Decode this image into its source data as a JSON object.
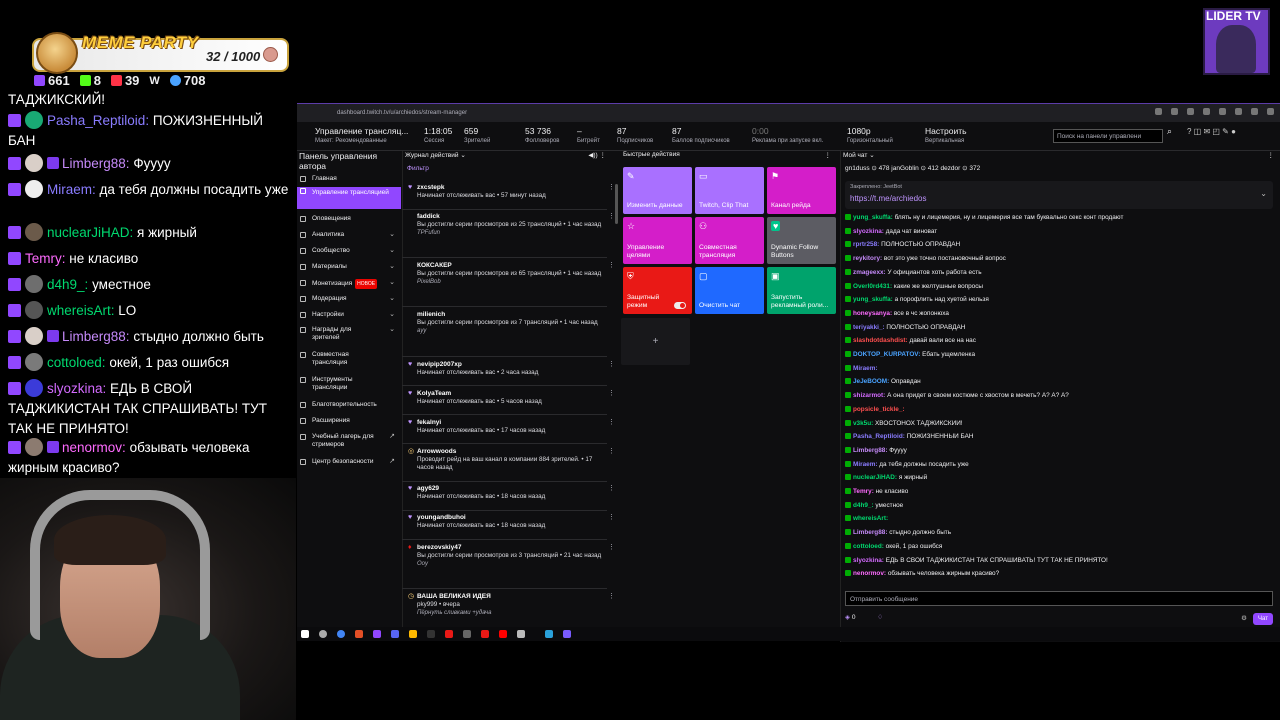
{
  "overlay": {
    "meme_title": "MEME PARTY",
    "meme_count": "32 / 1000",
    "stats": [
      {
        "icon": "twitch-icon",
        "value": "661",
        "color": "#9147ff"
      },
      {
        "icon": "kick-icon",
        "value": "8",
        "color": "#53fc18"
      },
      {
        "icon": "vk-live-icon",
        "value": "39",
        "color": "#ff3347"
      },
      {
        "icon": "w-icon",
        "value": "",
        "color": "#ffffff"
      },
      {
        "icon": "person-icon",
        "value": "708",
        "color": "#4aa3ff"
      }
    ],
    "messages": [
      {
        "user": "",
        "text": "ТАДЖИКСКИЙ!",
        "color": "#ffffff"
      },
      {
        "user": "Pasha_Reptiloid:",
        "text": "ПОЖИЗНЕННЫЙ БАН",
        "color": "#8a7cff"
      },
      {
        "user": "Limberg88:",
        "text": "Фуууу",
        "color": "#c58af9"
      },
      {
        "user": "Miraem:",
        "text": "да тебя должны посадить уже",
        "color": "#8a7cff"
      },
      {
        "user": "nuclearJiHAD:",
        "text": "я жирный",
        "color": "#00d96f"
      },
      {
        "user": "Temry:",
        "text": "не класиво",
        "color": "#ff6bff"
      },
      {
        "user": "d4h9_:",
        "text": "уместное",
        "color": "#00d96f"
      },
      {
        "user": "whereisArt:",
        "text": "LO",
        "color": "#00d96f"
      },
      {
        "user": "Limberg88:",
        "text": "стыдно должно быть",
        "color": "#c58af9"
      },
      {
        "user": "cottoloed:",
        "text": "окей, 1 раз ошибся",
        "color": "#00d96f"
      },
      {
        "user": "slyozkina:",
        "text": "ЕДЬ В СВОЙ ТАДЖИКИСТАН ТАК СПРАШИВАТЬ! ТУТ ТАК НЕ ПРИНЯТО!",
        "color": "#d46bff"
      },
      {
        "user": "nenormov:",
        "text": "обзывать человека жирным красиво?",
        "color": "#ff6bff"
      }
    ]
  },
  "lider": {
    "title": "LIDER TV"
  },
  "browser": {
    "url": "dashboard.twitch.tv/u/archiedos/stream-manager",
    "top": {
      "title": "Управление трансляц...",
      "layout": "Макет: Рекомендованные",
      "session_value": "1:18:05",
      "session_label": "Сессия",
      "viewers_value": "659",
      "viewers_label": "Зрителей",
      "followers_value": "53 736",
      "followers_label": "Фолловеров",
      "bitrate_value": "–",
      "bitrate_label": "Битрейт",
      "subs_value": "87",
      "subs_label": "Подписчиков",
      "points_value": "87",
      "points_label": "Баллов подписчиков",
      "ads_value": "0:00",
      "ads_label": "Реклама при запуске вкл.",
      "res_value": "1080p",
      "res_label": "Горизонтальный",
      "settings_value": "Настроить",
      "settings_label": "Вертикальная",
      "search_placeholder": "Поиск на панели управлени"
    },
    "sidebar": {
      "title": "Панель управления автора",
      "items": [
        {
          "label": "Главная"
        },
        {
          "label": "Управление трансляцией"
        },
        {
          "label": "Оповещения"
        },
        {
          "label": "Аналитика"
        },
        {
          "label": "Сообщество"
        },
        {
          "label": "Материалы"
        },
        {
          "label": "Монетизация",
          "badge": "НОВОЕ"
        },
        {
          "label": "Модерация"
        },
        {
          "label": "Настройки"
        },
        {
          "label": "Награды для зрителей"
        },
        {
          "label": "Совместная трансляция"
        },
        {
          "label": "Инструменты трансляции"
        },
        {
          "label": "Благотворительность"
        },
        {
          "label": "Расширения"
        },
        {
          "label": "Учебный лагерь для стримеров"
        },
        {
          "label": "Центр безопасности"
        }
      ]
    },
    "activity": {
      "title": "Журнал действий",
      "filter": "Фильтр",
      "items": [
        {
          "user": "zxcstepk",
          "text": "Начинает отслеживать вас • 57 минут назад",
          "note": ""
        },
        {
          "user": "faddick",
          "text": "Вы достигли серии просмотров из 25 трансляций • 1 час назад",
          "note": "TPFufun"
        },
        {
          "user": "КОКСАКЕР",
          "text": "Вы достигли серии просмотров из 65 трансляций • 1 час назад",
          "note": "PixelBob"
        },
        {
          "user": "milienich",
          "text": "Вы достигли серии просмотров из 7 трансляций • 1 час назад",
          "note": "ayy"
        },
        {
          "user": "nevipip2007xp",
          "text": "Начинает отслеживать вас • 2 часа назад",
          "note": ""
        },
        {
          "user": "KolyaTeam",
          "text": "Начинает отслеживать вас • 5 часов назад",
          "note": ""
        },
        {
          "user": "fekalnyi",
          "text": "Начинает отслеживать вас • 17 часов назад",
          "note": ""
        },
        {
          "user": "Arrowwoods",
          "text": "Проводит рейд на ваш канал в компании 884 зрителей. • 17 часов назад",
          "note": ""
        },
        {
          "user": "agy629",
          "text": "Начинает отслеживать вас • 18 часов назад",
          "note": ""
        },
        {
          "user": "youngandbuhoi",
          "text": "Начинает отслеживать вас • 18 часов назад",
          "note": ""
        },
        {
          "user": "berezovskiy47",
          "text": "Вы достигли серии просмотров из 3 трансляций • 21 час назад",
          "note": "Ooy"
        },
        {
          "user": "ВАША ВЕЛИКАЯ ИДЕЯ",
          "text": "pky999 • вчера",
          "note": "Пёрнуть сливками +удача"
        }
      ]
    },
    "quick": {
      "title": "Быстрые действия",
      "tiles": [
        {
          "label": "Изменить данные",
          "color": "#a970ff",
          "icon": "pencil-icon"
        },
        {
          "label": "Twitch, Clip That",
          "color": "#a970ff",
          "icon": "clip-icon"
        },
        {
          "label": "Канал рейда",
          "color": "#d41ec9",
          "icon": "raid-icon"
        },
        {
          "label": "Управление целями",
          "color": "#d41ec9",
          "icon": "star-icon"
        },
        {
          "label": "Совместная трансляция",
          "color": "#d41ec9",
          "icon": "person-add-icon"
        },
        {
          "label": "Dynamic Follow Buttons",
          "color": "#5c5c63",
          "icon": "heart-icon"
        },
        {
          "label": "Защитный режим",
          "color": "#e91916",
          "icon": "shield-icon"
        },
        {
          "label": "Очистить чат",
          "color": "#1f69ff",
          "icon": "chat-icon"
        },
        {
          "label": "Запустить рекламный роли...",
          "color": "#00a36c",
          "icon": "ad-icon"
        }
      ],
      "add_label": "+"
    },
    "mychat": {
      "title": "Мой чат",
      "leaderboard": "gn1duss ⊙ 478   janGoblin ⊙ 412   dezdor ⊙ 372",
      "pinned_by": "Закреплено: JeetBot",
      "pinned_link": "https://t.me/archiedos",
      "messages": [
        {
          "user": "yung_skuffa:",
          "text": "блять ну и лицемерия, ну и лицемерия все там буквально секс конт продают",
          "color": "#00d96f"
        },
        {
          "user": "slyozkina:",
          "text": "дада чат виноват",
          "color": "#d46bff"
        },
        {
          "user": "rprtr258:",
          "text": "ПОЛНОСТЬЮ ОПРАВДАН",
          "color": "#8a7cff"
        },
        {
          "user": "reykitory:",
          "text": "вот это уже точно постановочный вопрос",
          "color": "#c58af9"
        },
        {
          "user": "zmageexx:",
          "text": "У официантов хоть работа есть",
          "color": "#c58af9"
        },
        {
          "user": "Overl0rd431:",
          "text": "какие же желтушные вопросы",
          "color": "#00d96f"
        },
        {
          "user": "yung_skuffa:",
          "text": "а порофлить над хуетой нельзя",
          "color": "#00d96f"
        },
        {
          "user": "honeysanya:",
          "text": "все в чс жопонюха",
          "color": "#ff6bff"
        },
        {
          "user": "teriyakki_:",
          "text": "ПОЛНОСТЬЮ ОПРАВДАН",
          "color": "#8a7cff"
        },
        {
          "user": "slashdotdashdist:",
          "text": "давай вали все на нас",
          "color": "#ff4f4f"
        },
        {
          "user": "DOKTOP_KURPATOV:",
          "text": "Ебать ущемленка",
          "color": "#4aa3ff"
        },
        {
          "user": "Miraem:",
          "text": "",
          "color": "#8a7cff"
        },
        {
          "user": "JeJeBOOM:",
          "text": "Оправдан",
          "color": "#4aa3ff"
        },
        {
          "user": "shizarmot:",
          "text": "А она придет в своем костюме с хвостом в мечеть? А? А? А?",
          "color": "#d46bff"
        },
        {
          "user": "popsicle_tickle_:",
          "text": "",
          "color": "#ff4f4f"
        },
        {
          "user": "v3k5u:",
          "text": "ХВОСТОНОХ ТАДЖИКСКИЙ!",
          "color": "#00d96f"
        },
        {
          "user": "Pasha_Reptiloid:",
          "text": "ПОЖИЗНЕННЫЙ БАН",
          "color": "#8a7cff"
        },
        {
          "user": "Limberg88:",
          "text": "Фуууу",
          "color": "#c58af9"
        },
        {
          "user": "Miraem:",
          "text": "да тебя должны посадить уже",
          "color": "#8a7cff"
        },
        {
          "user": "nuclearJiHAD:",
          "text": "я жирный",
          "color": "#00d96f"
        },
        {
          "user": "Temry:",
          "text": "не класиво",
          "color": "#ff6bff"
        },
        {
          "user": "d4h9_:",
          "text": "уместное",
          "color": "#00d96f"
        },
        {
          "user": "whereisArt:",
          "text": "",
          "color": "#00d96f"
        },
        {
          "user": "Limberg88:",
          "text": "стыдно должно быть",
          "color": "#c58af9"
        },
        {
          "user": "cottoloed:",
          "text": "окей, 1 раз ошибся",
          "color": "#00d96f"
        },
        {
          "user": "slyozkina:",
          "text": "ЕДЬ В СВОЙ ТАДЖИКИСТАН ТАК СПРАШИВАТЬ! ТУТ ТАК НЕ ПРИНЯТО!",
          "color": "#d46bff"
        },
        {
          "user": "nenormov:",
          "text": "обзывать человека жирным красиво?",
          "color": "#ff6bff"
        }
      ],
      "input_placeholder": "Отправить сообщение",
      "points": "0",
      "chat_button": "Чат"
    }
  }
}
